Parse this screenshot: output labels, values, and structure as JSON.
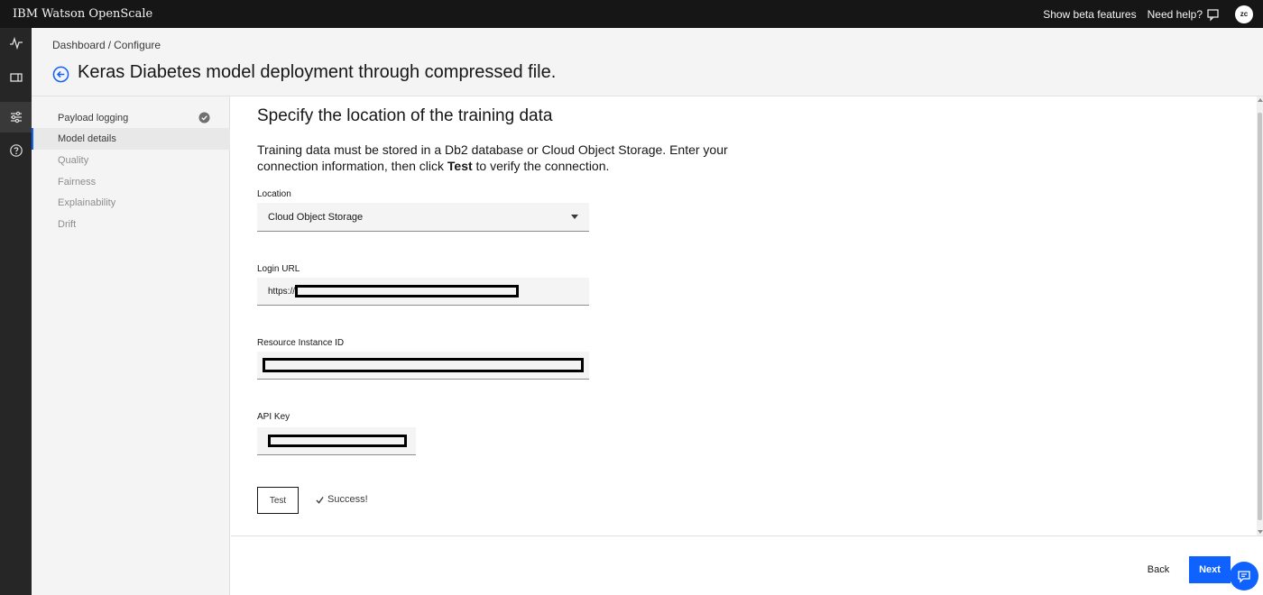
{
  "app": {
    "title": "IBM Watson OpenScale"
  },
  "topbar": {
    "beta_label": "Show beta features",
    "help_label": "Need help?",
    "avatar_initials": "zc"
  },
  "rail": {
    "items": [
      {
        "icon": "activity-icon"
      },
      {
        "icon": "deployments-icon"
      },
      {
        "icon": "configure-sliders-icon",
        "active": true
      },
      {
        "icon": "help-circle-icon"
      }
    ]
  },
  "breadcrumb": {
    "parent": "Dashboard",
    "separator": "/",
    "current": "Configure"
  },
  "page": {
    "title": "Keras Diabetes model deployment through compressed file."
  },
  "sidenav": {
    "items": [
      {
        "label": "Payload logging",
        "state": "done"
      },
      {
        "label": "Model details",
        "state": "current"
      },
      {
        "label": "Quality",
        "state": "pending"
      },
      {
        "label": "Fairness",
        "state": "pending"
      },
      {
        "label": "Explainability",
        "state": "pending"
      },
      {
        "label": "Drift",
        "state": "pending"
      }
    ]
  },
  "main": {
    "section_title": "Specify the location of the training data",
    "desc_part1": "Training data must be stored in a Db2 database or Cloud Object Storage. Enter your connection information, then click ",
    "desc_bold": "Test",
    "desc_part2": " to verify the connection.",
    "location": {
      "label": "Location",
      "value": "Cloud Object Storage"
    },
    "login_url": {
      "label": "Login URL",
      "prefix": "https://"
    },
    "resource_instance_id": {
      "label": "Resource Instance ID"
    },
    "api_key": {
      "label": "API Key"
    },
    "test_button": "Test",
    "success_text": "Success!"
  },
  "footer": {
    "back_label": "Back",
    "next_label": "Next"
  },
  "colors": {
    "accent": "#0f62fe",
    "topbar": "#161616",
    "rail": "#262626"
  }
}
